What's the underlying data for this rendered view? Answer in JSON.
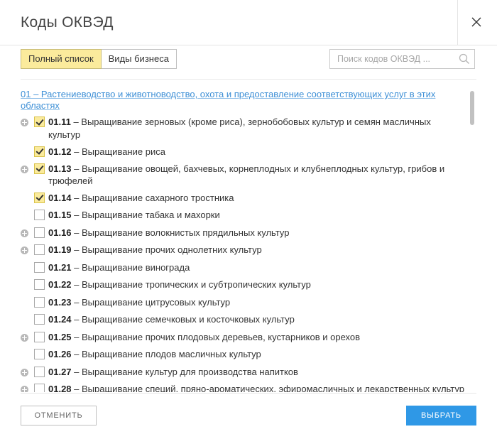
{
  "dialog": {
    "title": "Коды ОКВЭД",
    "close_icon": "close-icon"
  },
  "tabs": [
    {
      "label": "Полный список",
      "active": true
    },
    {
      "label": "Виды бизнеса",
      "active": false
    }
  ],
  "search": {
    "placeholder": "Поиск кодов ОКВЭД ...",
    "value": "",
    "icon": "search-icon"
  },
  "section": {
    "label": "01 – Растениеводство и животноводство, охота и предоставление соответствующих услуг в этих областях"
  },
  "items": [
    {
      "code": "01.11",
      "label": "– Выращивание зерновых (кроме риса), зернобобовых культур и семян масличных культур",
      "checked": true,
      "expandable": true
    },
    {
      "code": "01.12",
      "label": "– Выращивание риса",
      "checked": true,
      "expandable": false
    },
    {
      "code": "01.13",
      "label": "– Выращивание овощей, бахчевых, корнеплодных и клубнеплодных культур, грибов и трюфелей",
      "checked": true,
      "expandable": true
    },
    {
      "code": "01.14",
      "label": "– Выращивание сахарного тростника",
      "checked": true,
      "expandable": false
    },
    {
      "code": "01.15",
      "label": "– Выращивание табака и махорки",
      "checked": false,
      "expandable": false
    },
    {
      "code": "01.16",
      "label": "– Выращивание волокнистых прядильных культур",
      "checked": false,
      "expandable": true
    },
    {
      "code": "01.19",
      "label": "– Выращивание прочих однолетних культур",
      "checked": false,
      "expandable": true
    },
    {
      "code": "01.21",
      "label": "– Выращивание винограда",
      "checked": false,
      "expandable": false
    },
    {
      "code": "01.22",
      "label": "– Выращивание тропических и субтропических культур",
      "checked": false,
      "expandable": false
    },
    {
      "code": "01.23",
      "label": "– Выращивание цитрусовых культур",
      "checked": false,
      "expandable": false
    },
    {
      "code": "01.24",
      "label": "– Выращивание семечковых и косточковых культур",
      "checked": false,
      "expandable": false
    },
    {
      "code": "01.25",
      "label": "– Выращивание прочих плодовых деревьев, кустарников и орехов",
      "checked": false,
      "expandable": true
    },
    {
      "code": "01.26",
      "label": "– Выращивание плодов масличных культур",
      "checked": false,
      "expandable": false
    },
    {
      "code": "01.27",
      "label": "– Выращивание культур для производства напитков",
      "checked": false,
      "expandable": true
    },
    {
      "code": "01.28",
      "label": "– Выращивание специй, пряно-ароматических, эфиромасличных и лекарственных культур",
      "checked": false,
      "expandable": true
    }
  ],
  "footer": {
    "cancel_label": "ОТМЕНИТЬ",
    "ok_label": "ВЫБРАТЬ"
  },
  "colors": {
    "accent": "#2f98e6",
    "active_tab": "#fbeb9c",
    "link": "#3d8fd6"
  }
}
